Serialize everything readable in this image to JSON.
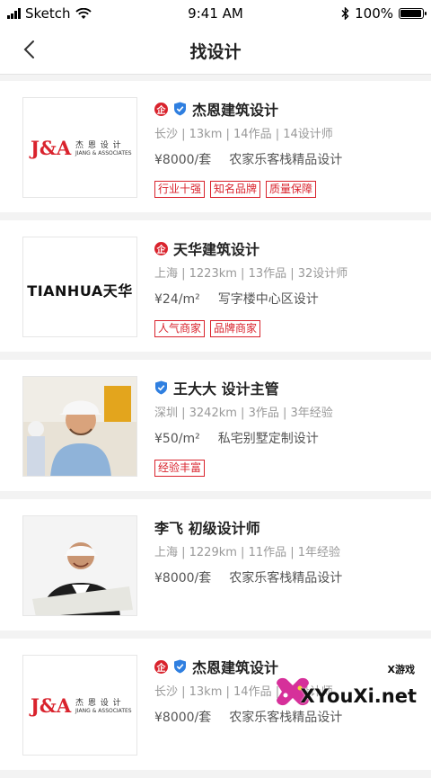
{
  "status_bar": {
    "carrier": "Sketch",
    "time": "9:41 AM",
    "battery": "100%"
  },
  "nav": {
    "title": "找设计"
  },
  "cards": [
    {
      "name": "杰恩建筑设计",
      "meta": "长沙 | 13km | 14作品 | 14设计师",
      "price": "¥8000/套",
      "desc": "农家乐客栈精品设计",
      "tags": [
        "行业十强",
        "知名品牌",
        "质量保障"
      ],
      "logo_text": "J&A",
      "logo_cn": "杰 恩 设 计",
      "logo_en": "JIANG & ASSOCIATES"
    },
    {
      "name": "天华建筑设计",
      "meta": "上海 | 1223km | 13作品 | 32设计师",
      "price": "¥24/m²",
      "desc": "写字楼中心区设计",
      "tags": [
        "人气商家",
        "品牌商家"
      ],
      "logo_text": "TIANHUA天华"
    },
    {
      "name": "王大大 设计主管",
      "meta": "深圳 | 3242km | 3作品 | 3年经验",
      "price": "¥50/m²",
      "desc": "私宅别墅定制设计",
      "tags": [
        "经验丰富"
      ]
    },
    {
      "name": "李飞 初级设计师",
      "meta": "上海 | 1229km | 11作品 | 1年经验",
      "price": "¥8000/套",
      "desc": "农家乐客栈精品设计",
      "tags": []
    },
    {
      "name": "杰恩建筑设计",
      "meta": "长沙 | 13km | 14作品 | 14设计师",
      "price": "¥8000/套",
      "desc": "农家乐客栈精品设计",
      "tags": [],
      "logo_text": "J&A",
      "logo_cn": "杰 恩 设 计",
      "logo_en": "JIANG & ASSOCIATES"
    }
  ],
  "watermark": {
    "small": "X游戏",
    "big": "XYouXi.net"
  },
  "badges": {
    "qi": "企"
  },
  "colors": {
    "accent_red": "#d9232d",
    "verified_blue": "#2f7fe0"
  }
}
